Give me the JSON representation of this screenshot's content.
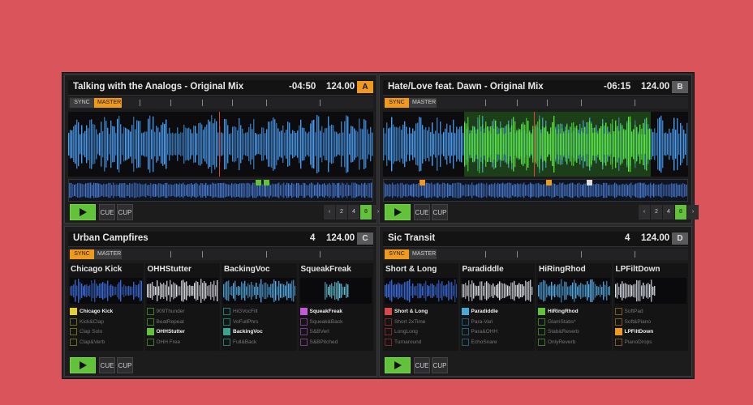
{
  "decks": [
    {
      "id": "A",
      "title": "Talking with the Analogs - Original Mix",
      "time": "-04:50",
      "bpm": "124.00",
      "sync": "SYNC",
      "master": "MASTER",
      "cue": "CUE",
      "cup": "CUP",
      "loop_sizes": [
        "‹",
        "2",
        "4",
        "8",
        "›"
      ],
      "active_loop": "8",
      "play_progress": 0.46
    },
    {
      "id": "B",
      "title": "Hate/Love feat. Dawn - Original Mix",
      "time": "-06:15",
      "bpm": "124.00",
      "sync": "SYNC",
      "master": "MASTER",
      "cue": "CUE",
      "cup": "CUP",
      "loop_sizes": [
        "‹",
        "2",
        "4",
        "8",
        "›"
      ],
      "active_loop": "8",
      "play_progress": 0.22
    },
    {
      "id": "C",
      "title": "Urban Campfires",
      "time": "4",
      "bpm": "124.00",
      "sync": "SYNC",
      "master": "MASTER",
      "cue": "CUE",
      "cup": "CUP",
      "slots": [
        {
          "name": "Chicago Kick",
          "cells": [
            "Chicago Kick",
            "Kick&Clap",
            "Clap Solo",
            "Clap&Verb"
          ]
        },
        {
          "name": "OHHStutter",
          "cells": [
            "909Thunder",
            "BeatRepeat",
            "OHHStutter",
            "OHH Free"
          ]
        },
        {
          "name": "BackingVoc",
          "cells": [
            "HiGVocFilt",
            "VoFullPhrs",
            "BackingVoc",
            "Full&Back"
          ]
        },
        {
          "name": "SqueakFreak",
          "cells": [
            "SqueakFreak",
            "Squeak&Back",
            "S&BVerl",
            "S&BPitched"
          ]
        }
      ]
    },
    {
      "id": "D",
      "title": "Sic Transit",
      "time": "4",
      "bpm": "124.00",
      "sync": "SYNC",
      "master": "MASTER",
      "cue": "CUE",
      "cup": "CUP",
      "slots": [
        {
          "name": "Short & Long",
          "cells": [
            "Short & Long",
            "Short 2xTime",
            "LongLong",
            "Turnaround"
          ]
        },
        {
          "name": "Paradiddle",
          "cells": [
            "Paradiddle",
            "Para-Vari",
            "Para&OHH",
            "EchoSnare"
          ]
        },
        {
          "name": "HiRingRhod",
          "cells": [
            "HiRingRhod",
            "GlamStabs*",
            "Stab&Reverb",
            "OnlyReverb"
          ]
        },
        {
          "name": "LPFiltDown",
          "cells": [
            "SoftPad",
            "Soft&Piano",
            "LPFiltDown",
            "PianoDrops"
          ]
        }
      ]
    }
  ],
  "colors": {
    "accent": "#f09a1d",
    "play": "#62c33a",
    "wave_blue": "#4fa6ff",
    "wave_green": "#5cf03a",
    "background": "#d9545b"
  }
}
